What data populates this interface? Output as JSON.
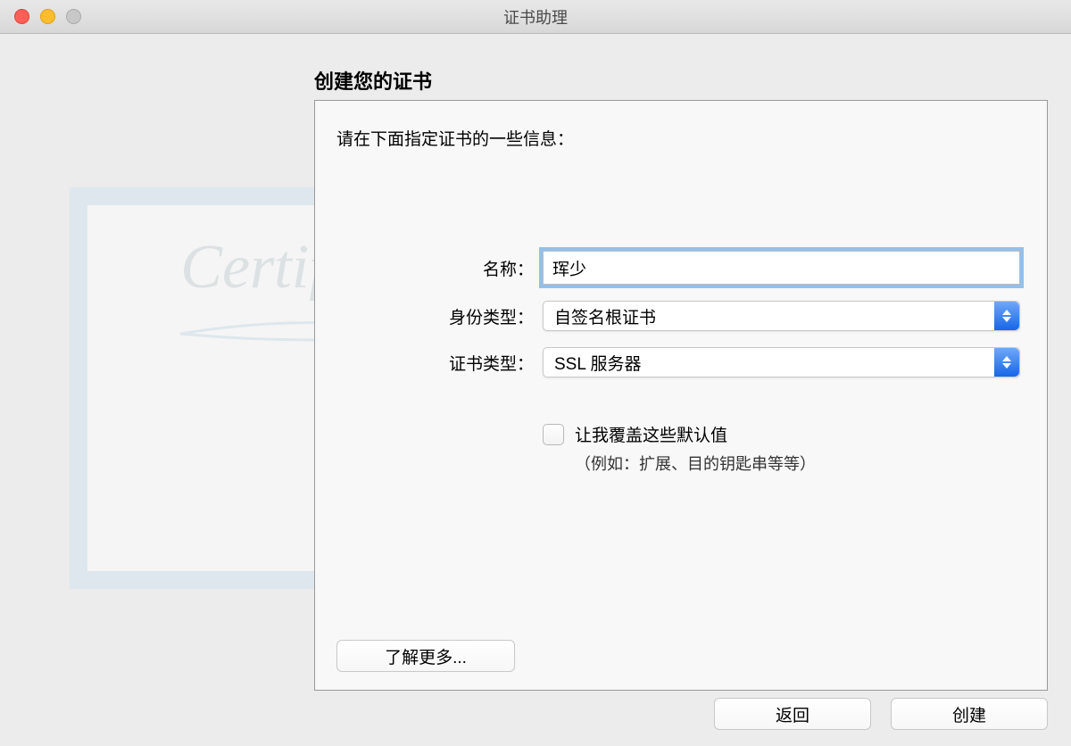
{
  "window": {
    "title": "证书助理"
  },
  "section_title": "创建您的证书",
  "instruction": "请在下面指定证书的一些信息：",
  "graphic": {
    "cursive_text": "Certificate"
  },
  "form": {
    "name_label": "名称：",
    "name_value": "珲少",
    "identity_label": "身份类型：",
    "identity_value": "自签名根证书",
    "cert_type_label": "证书类型：",
    "cert_type_value": "SSL 服务器",
    "override_label": "让我覆盖这些默认值",
    "override_sub": "（例如：扩展、目的钥匙串等等）"
  },
  "buttons": {
    "learn_more": "了解更多...",
    "back": "返回",
    "create": "创建"
  }
}
